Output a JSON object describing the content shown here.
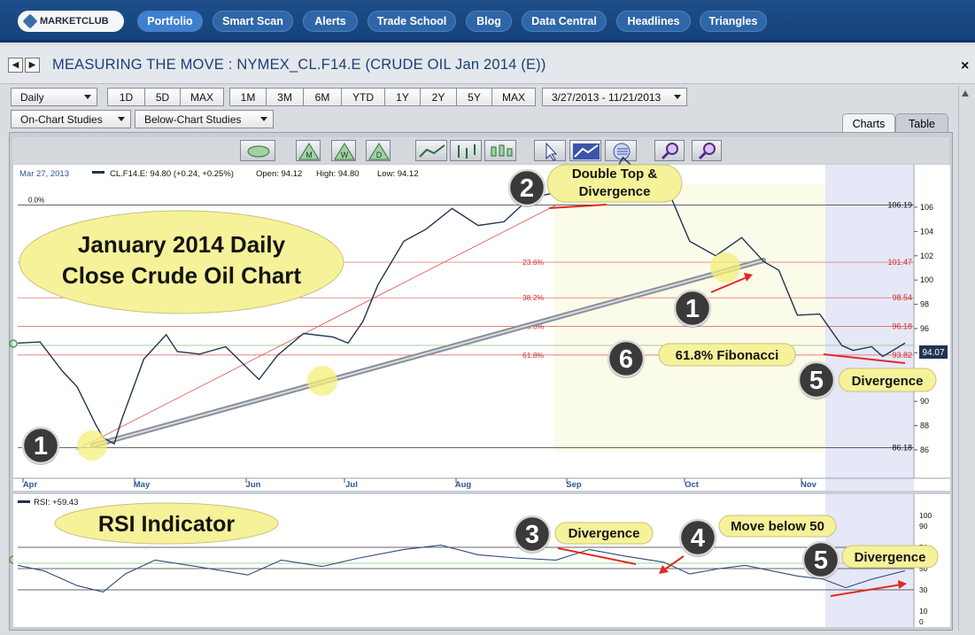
{
  "nav": {
    "logo": "MARKETCLUB",
    "items": [
      "Portfolio",
      "Smart Scan",
      "Alerts",
      "Trade School",
      "Blog",
      "Data Central",
      "Headlines",
      "Triangles"
    ]
  },
  "titlebar": {
    "title": "MEASURING THE MOVE : NYMEX_CL.F14.E (CRUDE OIL Jan 2014 (E))",
    "prev": "◀",
    "next": "▶",
    "close": "×"
  },
  "toolbar": {
    "period": "Daily",
    "ranges1": [
      "1D",
      "5D",
      "MAX"
    ],
    "ranges2": [
      "1M",
      "3M",
      "6M",
      "YTD",
      "1Y",
      "2Y",
      "5Y",
      "MAX"
    ],
    "daterange": "3/27/2013 - 11/21/2013",
    "on_chart": "On-Chart Studies",
    "below_chart": "Below-Chart Studies"
  },
  "tabs": {
    "charts": "Charts",
    "table": "Table"
  },
  "icons": [
    "grip-icon",
    "monthly-icon",
    "weekly-icon",
    "daily-icon",
    "line-chart-icon",
    "ohlc-icon",
    "candle-icon",
    "cursor-icon",
    "trendline-icon",
    "fibonacci-icon",
    "zoom-in-icon",
    "zoom-out-icon"
  ],
  "icon_letters": {
    "m": "M",
    "w": "W",
    "d": "D"
  },
  "infobar": {
    "date": "Mar 27, 2013",
    "symbol": "CL.F14.E: 94.80 (+0.24, +0.25%)",
    "open": "Open: 94.12",
    "high": "High: 94.80",
    "low": "Low: 94.12"
  },
  "price_axis": {
    "ticks": [
      "106",
      "104",
      "102",
      "100",
      "98",
      "96",
      "94",
      "92",
      "90",
      "88",
      "86"
    ]
  },
  "fib": {
    "levels": [
      {
        "pct": "0.0%",
        "value": "106.19",
        "price": 106.19
      },
      {
        "pct": "23.6%",
        "value": "101.47",
        "price": 101.47
      },
      {
        "pct": "38.2%",
        "value": "98.54",
        "price": 98.54
      },
      {
        "pct": "50.0%",
        "value": "96.18",
        "price": 96.18
      },
      {
        "pct": "61.8%",
        "value": "93.82",
        "price": 93.82
      },
      {
        "pct": "1",
        "value": "86.18",
        "price": 86.18
      }
    ],
    "last": "94.07"
  },
  "months": [
    "Apr",
    "May",
    "Jun",
    "Jul",
    "Aug",
    "Sep",
    "Oct",
    "Nov"
  ],
  "callouts": {
    "main_title": "January  2014 Daily Close Crude Oil Chart",
    "double_top": "Double Top & Divergence",
    "fib618": "61.8% Fibonacci",
    "divergence": "Divergence",
    "rsi_title": "RSI Indicator",
    "move_below": "Move below 50"
  },
  "badges": {
    "one": "1",
    "two": "2",
    "three": "3",
    "four": "4",
    "five": "5",
    "six": "6"
  },
  "rsi": {
    "label": "RSI: +59.43",
    "ticks": [
      "100",
      "90",
      "70",
      "50",
      "30",
      "10",
      "0"
    ]
  },
  "colors": {
    "nav": "#1d4f8c",
    "title": "#17407a",
    "price_line": "#1f3550",
    "fib": "#d0302a",
    "callout": "#f6f29a",
    "badge": "#333333",
    "shade": "#e6e8f8"
  },
  "chart_data": {
    "type": "line",
    "price_axis_range": [
      85,
      107
    ],
    "price_series": [
      [
        "2013-03-27",
        94.8
      ],
      [
        "2013-04-02",
        94.9
      ],
      [
        "2013-04-08",
        92.5
      ],
      [
        "2013-04-12",
        91.2
      ],
      [
        "2013-04-17",
        88.1
      ],
      [
        "2013-04-19",
        87.0
      ],
      [
        "2013-04-22",
        86.5
      ],
      [
        "2013-04-24",
        88.5
      ],
      [
        "2013-04-30",
        93.5
      ],
      [
        "2013-05-06",
        95.5
      ],
      [
        "2013-05-09",
        94.1
      ],
      [
        "2013-05-15",
        93.9
      ],
      [
        "2013-05-22",
        94.5
      ],
      [
        "2013-05-31",
        91.8
      ],
      [
        "2013-06-05",
        93.8
      ],
      [
        "2013-06-12",
        95.6
      ],
      [
        "2013-06-20",
        95.3
      ],
      [
        "2013-06-24",
        94.8
      ],
      [
        "2013-06-28",
        96.6
      ],
      [
        "2013-07-02",
        99.6
      ],
      [
        "2013-07-09",
        103.2
      ],
      [
        "2013-07-15",
        104.2
      ],
      [
        "2013-07-22",
        105.9
      ],
      [
        "2013-07-29",
        104.5
      ],
      [
        "2013-08-05",
        104.8
      ],
      [
        "2013-08-12",
        106.8
      ],
      [
        "2013-08-19",
        107.2
      ],
      [
        "2013-08-27",
        109.5
      ],
      [
        "2013-09-03",
        108.4
      ],
      [
        "2013-09-06",
        110.1
      ],
      [
        "2013-09-12",
        108.4
      ],
      [
        "2013-09-18",
        107.5
      ],
      [
        "2013-09-24",
        103.2
      ],
      [
        "2013-10-01",
        102.0
      ],
      [
        "2013-10-08",
        103.5
      ],
      [
        "2013-10-14",
        101.5
      ],
      [
        "2013-10-18",
        100.8
      ],
      [
        "2013-10-23",
        97.1
      ],
      [
        "2013-10-29",
        97.2
      ],
      [
        "2013-11-04",
        94.6
      ],
      [
        "2013-11-07",
        94.2
      ],
      [
        "2013-11-12",
        94.5
      ],
      [
        "2013-11-15",
        93.7
      ],
      [
        "2013-11-21",
        94.8
      ]
    ],
    "rsi_axis_range": [
      0,
      100
    ],
    "rsi_series": [
      [
        "2013-03-27",
        53
      ],
      [
        "2013-04-03",
        48
      ],
      [
        "2013-04-12",
        34
      ],
      [
        "2013-04-19",
        28
      ],
      [
        "2013-04-25",
        45
      ],
      [
        "2013-05-03",
        58
      ],
      [
        "2013-05-14",
        52
      ],
      [
        "2013-05-28",
        44
      ],
      [
        "2013-06-06",
        58
      ],
      [
        "2013-06-17",
        52
      ],
      [
        "2013-06-27",
        60
      ],
      [
        "2013-07-09",
        68
      ],
      [
        "2013-07-19",
        72
      ],
      [
        "2013-07-29",
        63
      ],
      [
        "2013-08-08",
        60
      ],
      [
        "2013-08-19",
        58
      ],
      [
        "2013-08-28",
        68
      ],
      [
        "2013-09-06",
        62
      ],
      [
        "2013-09-17",
        56
      ],
      [
        "2013-09-24",
        45
      ],
      [
        "2013-10-02",
        50
      ],
      [
        "2013-10-09",
        53
      ],
      [
        "2013-10-16",
        48
      ],
      [
        "2013-10-23",
        43
      ],
      [
        "2013-10-30",
        40
      ],
      [
        "2013-11-05",
        32
      ],
      [
        "2013-11-12",
        40
      ],
      [
        "2013-11-21",
        48
      ]
    ],
    "rsi_levels": [
      70,
      50,
      30
    ]
  }
}
